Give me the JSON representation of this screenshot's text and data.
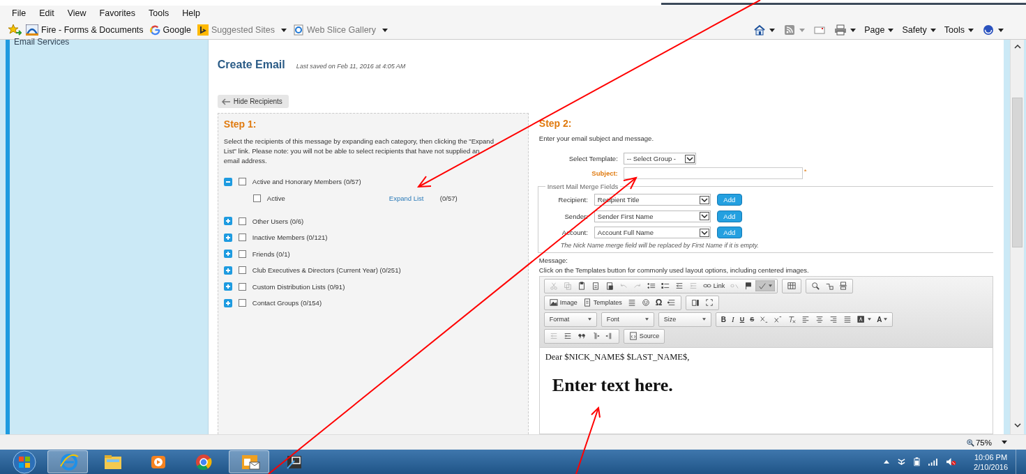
{
  "menu_bar": [
    "File",
    "Edit",
    "View",
    "Favorites",
    "Tools",
    "Help"
  ],
  "favorites_bar": [
    {
      "label": "Fire - Forms & Documents",
      "dimmed": false,
      "dropdown": false
    },
    {
      "label": "Google",
      "dimmed": false,
      "dropdown": false
    },
    {
      "label": "Suggested Sites",
      "dimmed": true,
      "dropdown": true
    },
    {
      "label": "Web Slice Gallery",
      "dimmed": true,
      "dropdown": true
    }
  ],
  "command_bar": [
    {
      "kind": "icon",
      "dropdown": true,
      "disabled": false
    },
    {
      "kind": "icon",
      "dropdown": true,
      "disabled": true
    },
    {
      "kind": "icon",
      "dropdown": false,
      "disabled": false
    },
    {
      "kind": "icon",
      "dropdown": true,
      "disabled": false
    },
    {
      "kind": "menu",
      "label": "Page",
      "dropdown": true,
      "disabled": false
    },
    {
      "kind": "menu",
      "label": "Safety",
      "dropdown": true,
      "disabled": false
    },
    {
      "kind": "menu",
      "label": "Tools",
      "dropdown": true,
      "disabled": false
    },
    {
      "kind": "icon",
      "dropdown": true,
      "disabled": false
    }
  ],
  "sidebar": {
    "title": "Email Services"
  },
  "compose": {
    "title": "Create Email",
    "last_saved": "Last saved on Feb 11, 2016 at 4:05 AM",
    "hide_button": "Hide Recipients"
  },
  "step1": {
    "heading": "Step 1:",
    "instructions": "Select the recipients of this message by expanding each category, then clicking the \"Expand List\" link. Please note: you will not be able to select recipients that have not supplied an email address.",
    "categories": [
      {
        "label": "Active and Honorary Members (0/57)",
        "expanded": true,
        "checked": false,
        "children": [
          {
            "label": "Active",
            "checked": false,
            "link": "Expand List",
            "count": "(0/57)"
          }
        ]
      },
      {
        "label": "Other Users (0/6)",
        "expanded": false,
        "checked": false
      },
      {
        "label": "Inactive Members (0/121)",
        "expanded": false,
        "checked": false
      },
      {
        "label": "Friends (0/1)",
        "expanded": false,
        "checked": false
      },
      {
        "label": "Club Executives & Directors (Current Year) (0/251)",
        "expanded": false,
        "checked": false
      },
      {
        "label": "Custom Distribution Lists (0/91)",
        "expanded": false,
        "checked": false
      },
      {
        "label": "Contact Groups (0/154)",
        "expanded": false,
        "checked": false
      }
    ]
  },
  "step2": {
    "heading": "Step 2:",
    "intro": "Enter your email subject and message.",
    "template_label": "Select Template:",
    "template_value": "-- Select Group -",
    "subject_label": "Subject:",
    "required_mark": "*",
    "merge_legend": "Insert Mail Merge Fields",
    "merge_fields": [
      {
        "label": "Recipient:",
        "value": "Recipient Title",
        "button": "Add"
      },
      {
        "label": "Sender:",
        "value": "Sender First Name",
        "button": "Add"
      },
      {
        "label": "Account:",
        "value": "Account Full Name",
        "button": "Add"
      }
    ],
    "merge_note": "The Nick Name merge field will be replaced by First Name if it is empty.",
    "message_label": "Message:",
    "message_hint": "Click on the Templates button for commonly used layout options, including centered images."
  },
  "editor": {
    "toolbar": [
      [
        [
          {
            "kind": "icon",
            "disabled": true,
            "pressed": false
          },
          {
            "kind": "icon",
            "disabled": true,
            "pressed": false
          },
          {
            "kind": "icon",
            "disabled": false,
            "pressed": false
          },
          {
            "kind": "icon",
            "disabled": false,
            "pressed": false
          },
          {
            "kind": "icon",
            "disabled": false,
            "pressed": false
          },
          {
            "kind": "icon",
            "disabled": true,
            "pressed": false
          },
          {
            "kind": "icon",
            "disabled": true,
            "pressed": false
          },
          {
            "kind": "icon",
            "disabled": false,
            "pressed": false
          },
          {
            "kind": "icon",
            "disabled": false,
            "pressed": false
          },
          {
            "kind": "icon",
            "disabled": false,
            "pressed": false
          },
          {
            "kind": "icon",
            "disabled": true,
            "pressed": false
          },
          {
            "kind": "icon-label",
            "text": "Link",
            "disabled": false,
            "pressed": false
          },
          {
            "kind": "icon",
            "disabled": true,
            "pressed": false
          },
          {
            "kind": "icon",
            "disabled": false,
            "pressed": false
          },
          {
            "kind": "icon-dropdown",
            "disabled": false,
            "pressed": true
          }
        ],
        [
          {
            "kind": "icon",
            "disabled": false,
            "pressed": false
          }
        ],
        [
          {
            "kind": "icon",
            "disabled": false,
            "pressed": false
          },
          {
            "kind": "icon",
            "disabled": false,
            "pressed": false
          },
          {
            "kind": "icon",
            "disabled": false,
            "pressed": false
          }
        ]
      ],
      [
        [
          {
            "kind": "icon-label",
            "text": "Image",
            "disabled": false,
            "pressed": false
          },
          {
            "kind": "icon-label",
            "text": "Templates",
            "disabled": false,
            "pressed": false
          },
          {
            "kind": "icon",
            "disabled": false,
            "pressed": false
          },
          {
            "kind": "icon",
            "disabled": false,
            "pressed": false
          },
          {
            "kind": "glyph",
            "text": "Ω",
            "disabled": false,
            "pressed": false
          },
          {
            "kind": "icon",
            "disabled": false,
            "pressed": false
          }
        ],
        [
          {
            "kind": "icon",
            "disabled": false,
            "pressed": false
          },
          {
            "kind": "icon",
            "disabled": false,
            "pressed": false
          }
        ]
      ],
      [
        [
          {
            "kind": "dropdown",
            "text": "Format",
            "disabled": false,
            "pressed": false
          }
        ],
        [
          {
            "kind": "dropdown",
            "text": "Font",
            "disabled": false,
            "pressed": false
          }
        ],
        [
          {
            "kind": "dropdown",
            "text": "Size",
            "disabled": false,
            "pressed": false
          }
        ],
        [
          {
            "kind": "glyph",
            "text": "B",
            "disabled": false,
            "pressed": false
          },
          {
            "kind": "glyph",
            "text": "I",
            "disabled": false,
            "pressed": false
          },
          {
            "kind": "glyph",
            "text": "U",
            "disabled": false,
            "pressed": false
          },
          {
            "kind": "glyph",
            "text": "S",
            "disabled": false,
            "pressed": false
          },
          {
            "kind": "icon",
            "disabled": false,
            "pressed": false
          },
          {
            "kind": "icon",
            "disabled": false,
            "pressed": false
          },
          {
            "kind": "icon",
            "disabled": false,
            "pressed": false
          },
          {
            "kind": "icon",
            "disabled": false,
            "pressed": false
          },
          {
            "kind": "icon",
            "disabled": false,
            "pressed": false
          },
          {
            "kind": "icon",
            "disabled": false,
            "pressed": false
          },
          {
            "kind": "icon",
            "disabled": false,
            "pressed": false
          },
          {
            "kind": "icon-dropdown",
            "disabled": false,
            "pressed": false
          },
          {
            "kind": "glyph-dropdown",
            "text": "A",
            "disabled": false,
            "pressed": false
          }
        ]
      ],
      [
        [
          {
            "kind": "icon",
            "disabled": true,
            "pressed": false
          },
          {
            "kind": "icon",
            "disabled": false,
            "pressed": false
          },
          {
            "kind": "icon",
            "disabled": false,
            "pressed": false
          },
          {
            "kind": "icon",
            "disabled": false,
            "pressed": false
          },
          {
            "kind": "icon",
            "disabled": false,
            "pressed": false
          }
        ],
        [
          {
            "kind": "icon-label",
            "text": "Source",
            "disabled": false,
            "pressed": false
          }
        ]
      ]
    ],
    "body": [
      "Dear $NICK_NAME$ $LAST_NAME$,"
    ],
    "callout": "Enter text here."
  },
  "status_bar": {
    "zoom": "75%"
  },
  "taskbar": {
    "apps": [
      {
        "selected": true
      },
      {
        "selected": false
      },
      {
        "selected": false
      },
      {
        "selected": false
      },
      {
        "selected": true
      },
      {
        "selected": false
      }
    ],
    "time": "10:06 PM",
    "date": "2/10/2016"
  }
}
